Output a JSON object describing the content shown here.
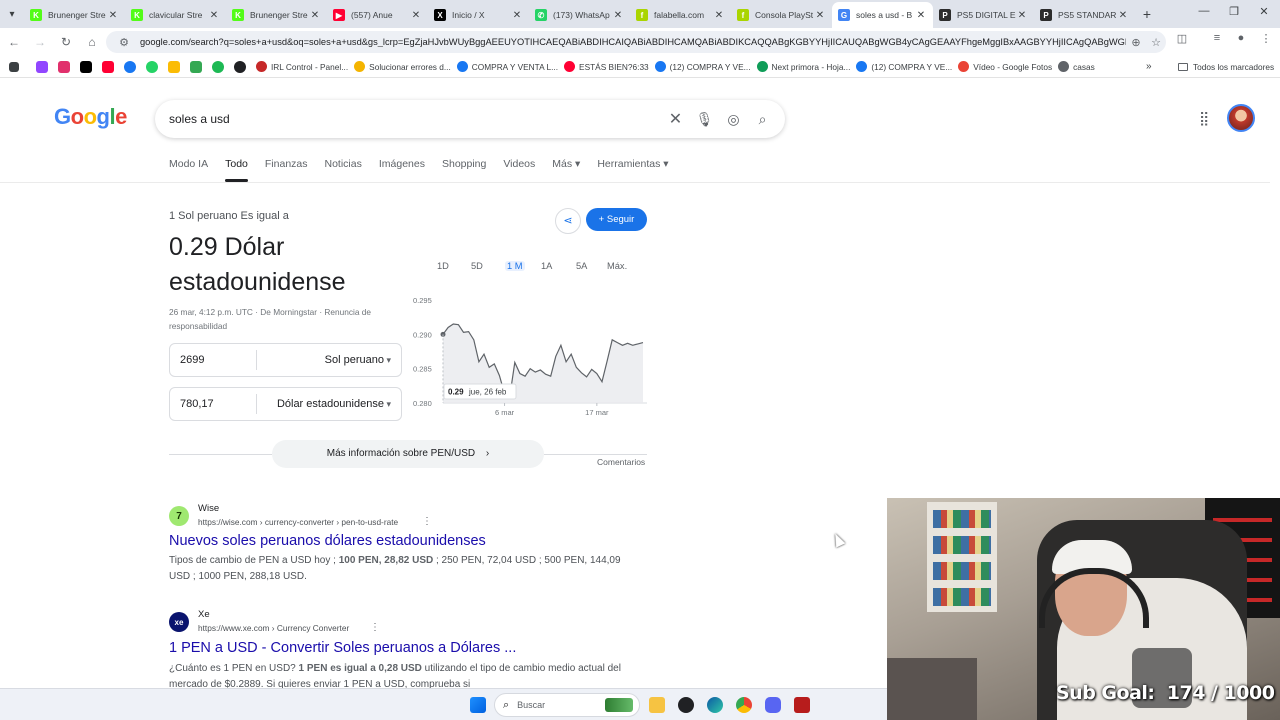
{
  "browser": {
    "tabs": [
      {
        "title": "Brunenger Stre",
        "fav_color": "#53fc18",
        "fav_text": "K"
      },
      {
        "title": "clavicular Stre",
        "fav_color": "#53fc18",
        "fav_text": "K"
      },
      {
        "title": "Brunenger Stre",
        "fav_color": "#53fc18",
        "fav_text": "K"
      },
      {
        "title": "(557) Anue",
        "fav_color": "#ff0033",
        "fav_text": "▶"
      },
      {
        "title": "Inicio / X",
        "fav_color": "#000000",
        "fav_text": "X"
      },
      {
        "title": "(173) WhatsAp",
        "fav_color": "#25d366",
        "fav_text": "✆"
      },
      {
        "title": "falabella.com",
        "fav_color": "#aad500",
        "fav_text": "f"
      },
      {
        "title": "Consola PlaySt",
        "fav_color": "#aad500",
        "fav_text": "f"
      },
      {
        "title": "soles a usd - B",
        "fav_color": "#4285f4",
        "fav_text": "G"
      },
      {
        "title": "PS5 DIGITAL E",
        "fav_color": "#2c2c2c",
        "fav_text": "P"
      },
      {
        "title": "PS5 STANDAR",
        "fav_color": "#2c2c2c",
        "fav_text": "P"
      }
    ],
    "active_tab_index": 8,
    "url": "google.com/search?q=soles+a+usd&oq=soles+a+usd&gs_lcrp=EgZjaHJvbWUyBggAEEUYOTIHCAEQABiABDIHCAIQABiABDIHCAMQABiABDIKCAQQABgKGBYYHjIICAUQABgWGB4yCAgGEAAYFhgeMggIBxAAGBYYHjIICAgQABgWGB4yCAgJ..."
  },
  "bookmarks": {
    "items": [
      {
        "label": "IRL Control - Panel...",
        "color": "#c62828"
      },
      {
        "label": "Solucionar errores d...",
        "color": "#f4b400"
      },
      {
        "label": "COMPRA Y VENTA L...",
        "color": "#1877f2"
      },
      {
        "label": "ESTÁS BIEN?6:33",
        "color": "#ff0033"
      },
      {
        "label": "(12) COMPRA Y VE...",
        "color": "#1877f2"
      },
      {
        "label": "Next primora - Hoja...",
        "color": "#0f9d58"
      },
      {
        "label": "(12) COMPRA Y VE...",
        "color": "#1877f2"
      },
      {
        "label": "Vídeo - Google Fotos",
        "color": "#ea4335"
      },
      {
        "label": "casas",
        "color": "#5f6368"
      }
    ],
    "all_label": "Todos los marcadores"
  },
  "search": {
    "logo_letters": [
      "G",
      "o",
      "o",
      "g",
      "l",
      "e"
    ],
    "query": "soles a usd",
    "tabs": [
      "Modo IA",
      "Todo",
      "Finanzas",
      "Noticias",
      "Imágenes",
      "Shopping",
      "Videos",
      "Más ▾",
      "Herramientas ▾"
    ]
  },
  "converter": {
    "subtitle": "1 Sol peruano Es igual a",
    "result": "0.29 Dólar estadounidense",
    "meta": "26 mar, 4:12 p.m. UTC · De Morningstar · Renuncia de responsabilidad",
    "from_amount": "2699",
    "from_currency": "Sol peruano",
    "to_amount": "780,17",
    "to_currency": "Dólar estadounidense",
    "follow_label": "Seguir",
    "more_info": "Más información sobre PEN/USD",
    "comments": "Comentarios"
  },
  "chart_data": {
    "type": "line",
    "ranges": [
      "1D",
      "5D",
      "1 M",
      "1A",
      "5A",
      "Máx."
    ],
    "active_range": "1 M",
    "y_ticks": [
      0.295,
      0.29,
      0.285,
      0.28
    ],
    "y_tick_labels": [
      "0.295",
      "0.290",
      "0.285",
      "0.280"
    ],
    "ylim": [
      0.28,
      0.295
    ],
    "x_tick_labels": [
      "6 mar",
      "17 mar"
    ],
    "series": [
      {
        "x": [
          0,
          1,
          2,
          3,
          4,
          5,
          6,
          7,
          8,
          9,
          10,
          11,
          12,
          13,
          14,
          15,
          16,
          17,
          18,
          19,
          20,
          21,
          22,
          23,
          24,
          25,
          26,
          27,
          28,
          29,
          30,
          31,
          32,
          33,
          34,
          35,
          36,
          37,
          38,
          39
        ],
        "values": [
          0.29,
          0.291,
          0.2915,
          0.2914,
          0.2903,
          0.2904,
          0.2892,
          0.286,
          0.2871,
          0.2852,
          0.2857,
          0.284,
          0.2814,
          0.2809,
          0.2859,
          0.2843,
          0.2839,
          0.285,
          0.2845,
          0.2848,
          0.2842,
          0.2839,
          0.2868,
          0.2884,
          0.286,
          0.2871,
          0.2852,
          0.2844,
          0.2838,
          0.2849,
          0.2843,
          0.2831,
          0.2861,
          0.2892,
          0.2888,
          0.2884,
          0.2887,
          0.2884,
          0.2886,
          0.2888
        ]
      }
    ],
    "tooltip_value": "0.29",
    "tooltip_date": "jue, 26 feb"
  },
  "results": [
    {
      "site": "Wise",
      "url": "https://wise.com › currency-converter › pen-to-usd-rate",
      "title": "Nuevos soles peruanos dólares estadounidenses",
      "snippet_pre": "Tipos de cambio de PEN a USD hoy ; ",
      "snippet_bold": "100 PEN, 28,82 USD",
      "snippet_post": " ; 250 PEN, 72,04 USD ; 500 PEN, 144,09 USD ; 1000 PEN, 288,18 USD.",
      "fav_color": "#163300",
      "fav_text": "7"
    },
    {
      "site": "Xe",
      "url": "https://www.xe.com › Currency Converter",
      "title": "1 PEN a USD - Convertir Soles peruanos a Dólares ...",
      "snippet_pre": "¿Cuánto es 1 PEN en USD? ",
      "snippet_bold": "1 PEN es igual a 0,28 USD",
      "snippet_post": " utilizando el tipo de cambio medio actual del mercado de $0.2889. Si quieres enviar 1 PEN a USD, comprueba si",
      "fav_color": "#0a146e",
      "fav_text": "xe"
    }
  ],
  "taskbar": {
    "search_label": "Buscar"
  },
  "stream": {
    "goal_label": "Sub Goal:",
    "goal_value": "174 / 1000"
  }
}
